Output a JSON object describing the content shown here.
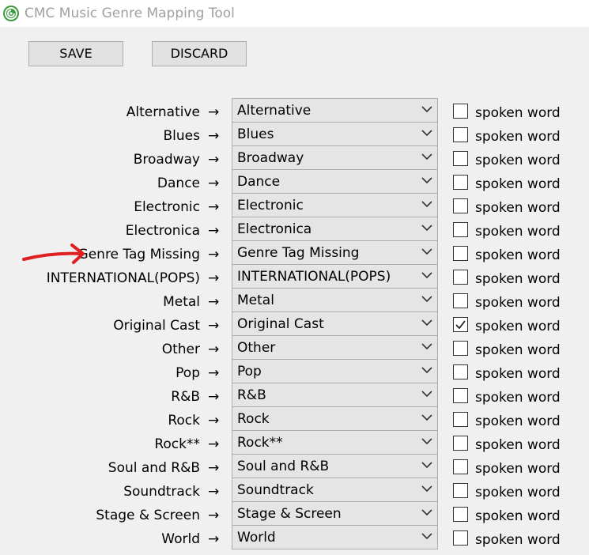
{
  "window": {
    "title": "CMC Music Genre Mapping Tool",
    "icon": "app-logo-icon",
    "accent_color": "#3a9a3a"
  },
  "toolbar": {
    "save_label": "SAVE",
    "discard_label": "DISCARD"
  },
  "arrow_symbol": "→",
  "checkbox_label": "spoken word",
  "annotation": {
    "icon": "red-arrow-annotation-icon",
    "color": "#e02020"
  },
  "mappings": [
    {
      "source": "Alternative",
      "target": "Alternative",
      "spoken_word": false
    },
    {
      "source": "Blues",
      "target": "Blues",
      "spoken_word": false
    },
    {
      "source": "Broadway",
      "target": "Broadway",
      "spoken_word": false
    },
    {
      "source": "Dance",
      "target": "Dance",
      "spoken_word": false
    },
    {
      "source": "Electronic",
      "target": "Electronic",
      "spoken_word": false
    },
    {
      "source": "Electronica",
      "target": "Electronica",
      "spoken_word": false
    },
    {
      "source": "Genre Tag Missing",
      "target": "Genre Tag Missing",
      "spoken_word": false
    },
    {
      "source": "INTERNATIONAL(POPS)",
      "target": "INTERNATIONAL(POPS)",
      "spoken_word": false
    },
    {
      "source": "Metal",
      "target": "Metal",
      "spoken_word": false
    },
    {
      "source": "Original Cast",
      "target": "Original Cast",
      "spoken_word": true
    },
    {
      "source": "Other",
      "target": "Other",
      "spoken_word": false
    },
    {
      "source": "Pop",
      "target": "Pop",
      "spoken_word": false
    },
    {
      "source": "R&B",
      "target": "R&B",
      "spoken_word": false
    },
    {
      "source": "Rock",
      "target": "Rock",
      "spoken_word": false
    },
    {
      "source": "Rock**",
      "target": "Rock**",
      "spoken_word": false
    },
    {
      "source": "Soul and R&B",
      "target": "Soul and R&B",
      "spoken_word": false
    },
    {
      "source": "Soundtrack",
      "target": "Soundtrack",
      "spoken_word": false
    },
    {
      "source": "Stage & Screen",
      "target": "Stage & Screen",
      "spoken_word": false
    },
    {
      "source": "World",
      "target": "World",
      "spoken_word": false
    }
  ]
}
